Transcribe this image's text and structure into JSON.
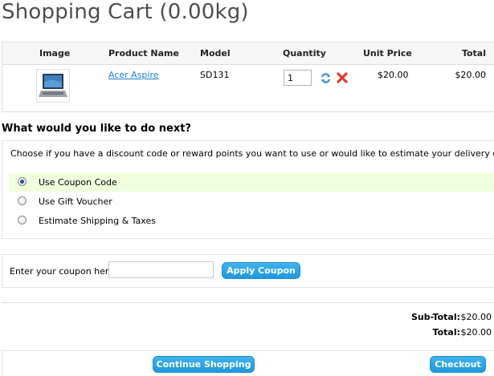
{
  "page": {
    "title": "Shopping Cart  (0.00kg)"
  },
  "cart": {
    "headers": {
      "image": "Image",
      "product_name": "Product Name",
      "model": "Model",
      "quantity": "Quantity",
      "unit_price": "Unit Price",
      "total": "Total"
    },
    "rows": [
      {
        "product_name": "Acer Aspire",
        "model": "SD131",
        "quantity": "1",
        "unit_price": "$20.00",
        "total": "$20.00",
        "image_icon": "laptop-thumbnail",
        "update_icon": "refresh-icon",
        "remove_icon": "remove-icon"
      }
    ]
  },
  "next": {
    "heading": "What would you like to do next?",
    "intro": "Choose if you have a discount code or reward points you want to use or would like to estimate your delivery cost.",
    "options": [
      {
        "label": "Use Coupon Code",
        "checked": true
      },
      {
        "label": "Use Gift Voucher",
        "checked": false
      },
      {
        "label": "Estimate Shipping & Taxes",
        "checked": false
      }
    ]
  },
  "coupon": {
    "label": "Enter your coupon here:",
    "value": "",
    "button": "Apply Coupon"
  },
  "totals": {
    "subtotal_label": "Sub-Total:",
    "subtotal_value": "$20.00",
    "total_label": "Total:",
    "total_value": "$20.00"
  },
  "actions": {
    "continue": "Continue Shopping",
    "checkout": "Checkout"
  },
  "colors": {
    "accent_button": "#27a4e8",
    "link": "#1b7fcc",
    "selected_option_bg": "#efffde",
    "remove_icon": "#e53a2c"
  }
}
